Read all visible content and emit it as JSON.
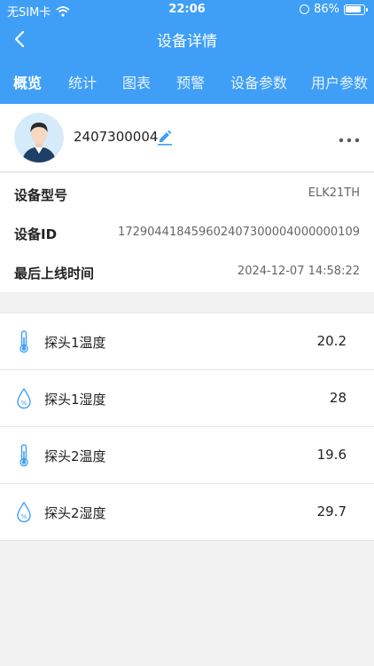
{
  "status_bar": {
    "carrier": "无SIM卡",
    "time": "22:06",
    "battery": "86%"
  },
  "nav": {
    "title": "设备详情"
  },
  "tabs": [
    {
      "label": "概览",
      "active": true
    },
    {
      "label": "统计"
    },
    {
      "label": "图表"
    },
    {
      "label": "预警"
    },
    {
      "label": "设备参数"
    },
    {
      "label": "用户参数"
    }
  ],
  "device": {
    "name": "2407300004"
  },
  "info": [
    {
      "label": "设备型号",
      "value": "ELK21TH"
    },
    {
      "label": "设备ID",
      "value": "17290441845960240730000400000010​9"
    },
    {
      "label": "最后上线时间",
      "value": "2024-12-07 14:58:22"
    }
  ],
  "sensors": [
    {
      "icon": "thermometer-icon",
      "label": "探头1温度",
      "value": "20.2"
    },
    {
      "icon": "humidity-drop-icon",
      "label": "探头1湿度",
      "value": "28"
    },
    {
      "icon": "thermometer-icon",
      "label": "探头2温度",
      "value": "19.6"
    },
    {
      "icon": "humidity-drop-icon",
      "label": "探头2湿度",
      "value": "29.7"
    }
  ],
  "colors": {
    "accent": "#3f9ff7",
    "background": "#f2f2f2"
  }
}
